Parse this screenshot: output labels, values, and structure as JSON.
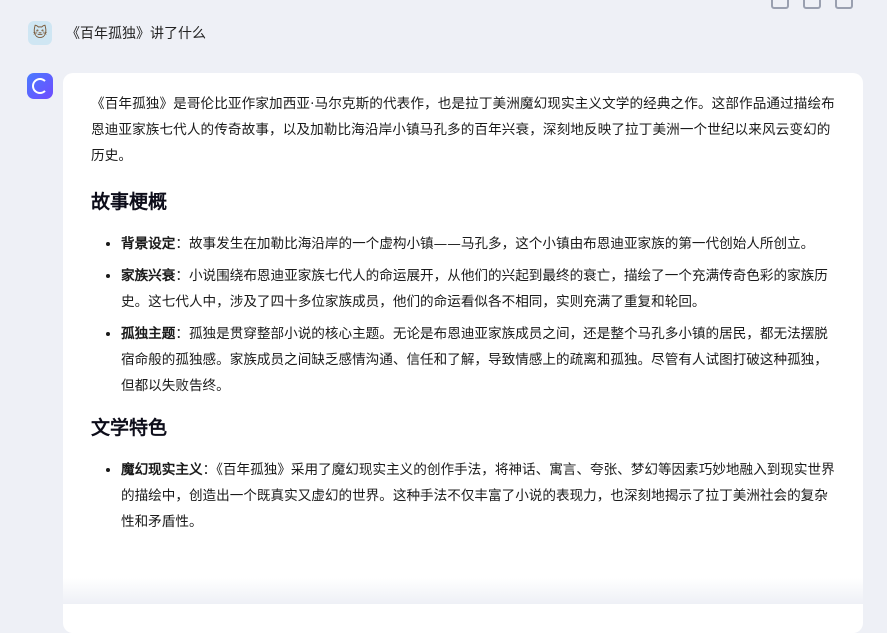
{
  "user": {
    "message": "《百年孤独》讲了什么",
    "avatar_icon": "cat-avatar-icon"
  },
  "assistant": {
    "avatar_icon": "assistant-logo-icon",
    "intro": "《百年孤独》是哥伦比亚作家加西亚·马尔克斯的代表作，也是拉丁美洲魔幻现实主义文学的经典之作。这部作品通过描绘布恩迪亚家族七代人的传奇故事，以及加勒比海沿岸小镇马孔多的百年兴衰，深刻地反映了拉丁美洲一个世纪以来风云变幻的历史。",
    "sections": [
      {
        "heading": "故事梗概",
        "items": [
          {
            "term": "背景设定",
            "text": "：故事发生在加勒比海沿岸的一个虚构小镇——马孔多，这个小镇由布恩迪亚家族的第一代创始人所创立。"
          },
          {
            "term": "家族兴衰",
            "text": "：小说围绕布恩迪亚家族七代人的命运展开，从他们的兴起到最终的衰亡，描绘了一个充满传奇色彩的家族历史。这七代人中，涉及了四十多位家族成员，他们的命运看似各不相同，实则充满了重复和轮回。"
          },
          {
            "term": "孤独主题",
            "text": "：孤独是贯穿整部小说的核心主题。无论是布恩迪亚家族成员之间，还是整个马孔多小镇的居民，都无法摆脱宿命般的孤独感。家族成员之间缺乏感情沟通、信任和了解，导致情感上的疏离和孤独。尽管有人试图打破这种孤独，但都以失败告终。"
          }
        ]
      },
      {
        "heading": "文学特色",
        "items": [
          {
            "term": "魔幻现实主义",
            "text": "：《百年孤独》采用了魔幻现实主义的创作手法，将神话、寓言、夸张、梦幻等因素巧妙地融入到现实世界的描绘中，创造出一个既真实又虚幻的世界。这种手法不仅丰富了小说的表现力，也深刻地揭示了拉丁美洲社会的复杂性和矛盾性。"
          }
        ]
      }
    ]
  }
}
